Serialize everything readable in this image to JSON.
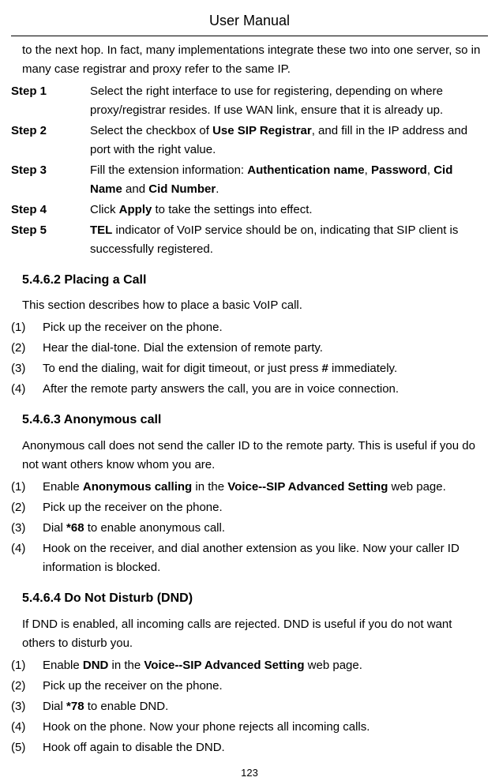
{
  "header": "User Manual",
  "intro": "to the next hop. In fact, many implementations integrate these two into one server, so in many case registrar and proxy refer to the same IP.",
  "steps": [
    {
      "label": "Step 1",
      "prefix": "Select the right interface to use for registering, depending on where proxy/registrar resides. If use WAN link, ensure that it is already up."
    },
    {
      "label": "Step 2",
      "prefix": "Select the checkbox of ",
      "bold1": "Use SIP Registrar",
      "suffix": ", and fill in the IP address and port with the right value."
    },
    {
      "label": "Step 3",
      "prefix": "Fill the extension information: ",
      "bold1": "Authentication name",
      "mid1": ", ",
      "bold2": "Password",
      "mid2": ", ",
      "bold3": "Cid Name",
      "mid3": " and ",
      "bold4": "Cid Number",
      "suffix": "."
    },
    {
      "label": "Step 4",
      "prefix": "Click ",
      "bold1": "Apply",
      "suffix": " to take the settings into effect."
    },
    {
      "label": "Step 5",
      "bold1": "TEL",
      "suffix": " indicator of VoIP service should be on, indicating that SIP client is successfully registered."
    }
  ],
  "section1": {
    "heading": "5.4.6.2  Placing a Call",
    "intro": "This section describes how to place a basic VoIP call.",
    "items": [
      {
        "num": "(1)",
        "text": "Pick up the receiver on the phone."
      },
      {
        "num": "(2)",
        "text": "Hear the dial-tone. Dial the extension of remote party."
      },
      {
        "num": "(3)",
        "prefix": "To end the dialing, wait for digit timeout, or just press ",
        "bold": "#",
        "suffix": " immediately."
      },
      {
        "num": "(4)",
        "text": "After the remote party answers the call, you are in voice connection."
      }
    ]
  },
  "section2": {
    "heading": "5.4.6.3  Anonymous call",
    "intro": "Anonymous call does not send the caller ID to the remote party. This is useful if you do not want others know whom you are.",
    "items": [
      {
        "num": "(1)",
        "prefix": "Enable ",
        "bold1": "Anonymous calling",
        "mid": " in the ",
        "bold2": "Voice--SIP Advanced Setting",
        "suffix": " web page."
      },
      {
        "num": "(2)",
        "text": "Pick up the receiver on the phone."
      },
      {
        "num": "(3)",
        "prefix": "Dial ",
        "bold1": "*68",
        "suffix": " to enable anonymous call."
      },
      {
        "num": "(4)",
        "text": "Hook on the receiver, and dial another extension as you like. Now your caller ID information is blocked."
      }
    ]
  },
  "section3": {
    "heading": "5.4.6.4  Do Not Disturb (DND)",
    "intro": "If DND is enabled, all incoming calls are rejected. DND is useful if you do not want others to disturb you.",
    "items": [
      {
        "num": "(1)",
        "prefix": "Enable ",
        "bold1": "DND",
        "mid": " in the ",
        "bold2": "Voice--SIP Advanced Setting",
        "suffix": " web page."
      },
      {
        "num": "(2)",
        "text": "Pick up the receiver on the phone."
      },
      {
        "num": "(3)",
        "prefix": "Dial ",
        "bold1": "*78",
        "suffix": " to enable DND."
      },
      {
        "num": "(4)",
        "text": "Hook on the phone. Now your phone rejects all incoming calls."
      },
      {
        "num": "(5)",
        "text": "Hook off again to disable the DND."
      }
    ]
  },
  "pageNumber": "123"
}
